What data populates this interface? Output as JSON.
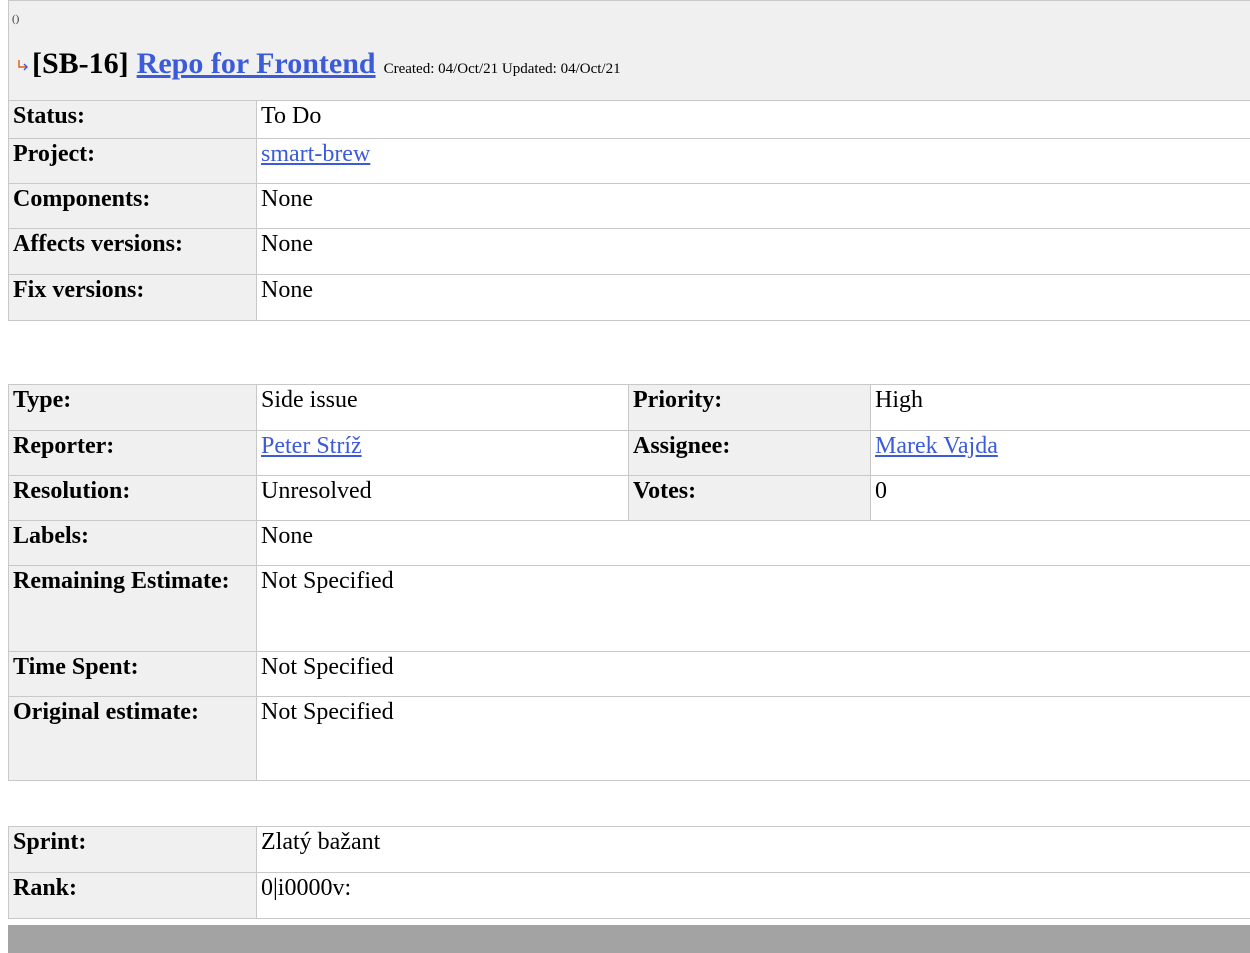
{
  "breadcrumb": "()",
  "issue": {
    "icon": "subtask-arrow-icon",
    "key": "[SB-16]",
    "title": "Repo for Frontend",
    "meta": "Created: 04/Oct/21  Updated: 04/Oct/21"
  },
  "summary_fields": [
    {
      "label": "Status:",
      "value": "To Do"
    },
    {
      "label": "Project:",
      "value": "smart-brew"
    },
    {
      "label": "Components:",
      "value": "None"
    },
    {
      "label": "Affects versions:",
      "value": "None"
    },
    {
      "label": "Fix versions:",
      "value": "None"
    }
  ],
  "details": {
    "type_label": "Type:",
    "type_value": "Side issue",
    "priority_label": "Priority:",
    "priority_value": "High",
    "reporter_label": "Reporter:",
    "reporter_value": "Peter Stríž",
    "assignee_label": "Assignee:",
    "assignee_value": "Marek Vajda",
    "resolution_label": "Resolution:",
    "resolution_value": "Unresolved",
    "votes_label": "Votes:",
    "votes_value": "0",
    "labels_label": "Labels:",
    "labels_value": "None",
    "remaining_label": "Remaining Estimate:",
    "remaining_value": "Not Specified",
    "timespent_label": "Time Spent:",
    "timespent_value": "Not Specified",
    "original_label": "Original estimate:",
    "original_value": "Not Specified"
  },
  "agile": [
    {
      "label": "Sprint:",
      "value": "Zlatý bažant"
    },
    {
      "label": "Rank:",
      "value": "0|i0000v:"
    }
  ],
  "colors": {
    "link": "#3b5bdb",
    "label_bg": "#f0f0f0",
    "border": "#c8c8c8",
    "footer_bar": "#a3a3a3"
  }
}
